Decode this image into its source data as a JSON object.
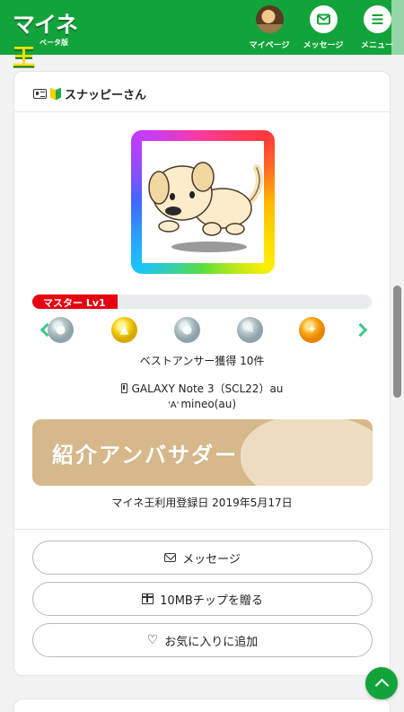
{
  "header": {
    "logo_main_a": "マイネ",
    "logo_main_b": "王",
    "logo_sub": "ベータ版",
    "nav": [
      {
        "label": "マイページ",
        "icon": "avatar-icon"
      },
      {
        "label": "メッセージ",
        "icon": "mail-icon"
      },
      {
        "label": "メニュー",
        "icon": "hamburger-menu-icon"
      }
    ],
    "brand_color": "#12a43a"
  },
  "profile": {
    "name": "スナッピーさん",
    "avatar_icon": "puppy-illustration",
    "level": {
      "label": "マスター Lv1",
      "progress": 0.25,
      "color": "#e60012"
    },
    "badges": [
      {
        "icon": "silver-bubble-medal-icon",
        "color": "silver"
      },
      {
        "icon": "gold-thumbs-up-medal-icon",
        "color": "gold"
      },
      {
        "icon": "silver-bubble-medal-icon",
        "color": "silver"
      },
      {
        "icon": "silver-pen-medal-icon",
        "color": "silver"
      },
      {
        "icon": "orange-handshake-medal-icon",
        "color": "orange"
      }
    ],
    "best_answer": "ベストアンサー獲得 10件",
    "device": "GALAXY Note 3（SCL22）au",
    "carrier": "mineo(au)",
    "ambassador_banner": "紹介アンバサダー",
    "registration": "マイネ王利用登録日 2019年5月17日"
  },
  "actions": {
    "message": "メッセージ",
    "gift_chip": "10MBチップを贈る",
    "favorite": "お気に入りに追加"
  }
}
